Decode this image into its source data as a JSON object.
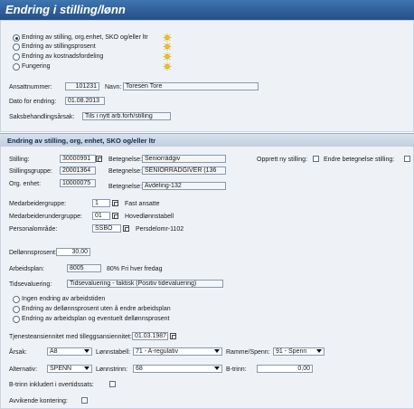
{
  "title": "Endring i stilling/lønn",
  "options": [
    {
      "label": "Endring av stilling, org.enhet, SKO og/eller ltr",
      "selected": true
    },
    {
      "label": "Endring av stillingsprosent",
      "selected": false
    },
    {
      "label": "Endring av kostnadsfordeling",
      "selected": false
    },
    {
      "label": "Fungering",
      "selected": false
    }
  ],
  "ansattnummer": {
    "label": "Ansattnummer:",
    "value": "101231"
  },
  "navn": {
    "label": "Navn:",
    "value": "Toresen Tore"
  },
  "dato": {
    "label": "Dato for endring:",
    "value": "01.08.2013"
  },
  "saksbehandlingsarsak": {
    "label": "Saksbehandlingsårsak:",
    "value": "Tils i nytt arb.forh/stilling"
  },
  "section": {
    "title": "Endring av stilling, org, enhet, SKO og/eller ltr"
  },
  "stilling": {
    "label": "Stilling:",
    "value": "30000991",
    "betegnelse_label": "Betegnelse:",
    "betegnelse": "Seniorrådgiv"
  },
  "opprett": {
    "label": "Opprett ny stilling:"
  },
  "endre_betegnelse": {
    "label": "Endre betegnelse stilling:"
  },
  "stillingsgruppe": {
    "label": "Stillingsgruppe:",
    "value": "20001364",
    "betegnelse_label": "Betegnelse:",
    "betegnelse": "SENIORRÅDGIVER (136"
  },
  "org": {
    "label": "Org. enhet:",
    "value": "10000075",
    "betegnelse_label": "Betegnelse:",
    "betegnelse": "Avdeling-132"
  },
  "medarbeidergruppe": {
    "label": "Medarbeidergruppe:",
    "value": "1",
    "text": "Fast ansatte"
  },
  "medarbeiderundergruppe": {
    "label": "Medarbeiderundergruppe:",
    "value": "01",
    "text": "Hovedlønnstabell"
  },
  "personalomrade": {
    "label": "Personalområde:",
    "value": "SSBO",
    "text": "Persdelomr-1102"
  },
  "dellonnsprosent": {
    "label": "Dellønnsprosent:",
    "value": "30,00"
  },
  "arbeidsplan": {
    "label": "Arbeidsplan:",
    "value": "8005",
    "text": "80% Fri hver fredag"
  },
  "tidsevaluering": {
    "label": "Tidsevaluering:",
    "value": "Tidsevaluering - faktisk (Positiv tidevaluering)"
  },
  "work_options": [
    {
      "label": "Ingen endring av arbeidstiden"
    },
    {
      "label": "Endring av dellønnsprosent uten å endre arbeidsplan"
    },
    {
      "label": "Endring av arbeidsplan og eventuelt dellønnsprosent"
    }
  ],
  "tjenesteansiennitet": {
    "label": "Tjenesteansiennitet med tilleggsansiennitet:",
    "value": "01.03.1987"
  },
  "arsak": {
    "label": "Årsak:",
    "value": "A8"
  },
  "lonnstabell": {
    "label": "Lønnstabell:",
    "value": "71 - A-regulativ"
  },
  "ramme": {
    "label": "Ramme/Spenn:",
    "value": "91 - Spenn"
  },
  "alternativ": {
    "label": "Alternativ:",
    "value": "SPENN"
  },
  "lonnstrinn": {
    "label": "Lønnstrinn:",
    "value": "68"
  },
  "btrinn": {
    "label": "B-trinn:",
    "value": "0,00"
  },
  "btrinn_inkludert": {
    "label": "B-trinn inkludert i overtidssats:"
  },
  "avvikende": {
    "label": "Avvikende kontering:"
  },
  "colors": {
    "title_bg": "#2f5f9a",
    "panel_bg": "#eef2f7",
    "header_bg": "#cfd9e6"
  }
}
